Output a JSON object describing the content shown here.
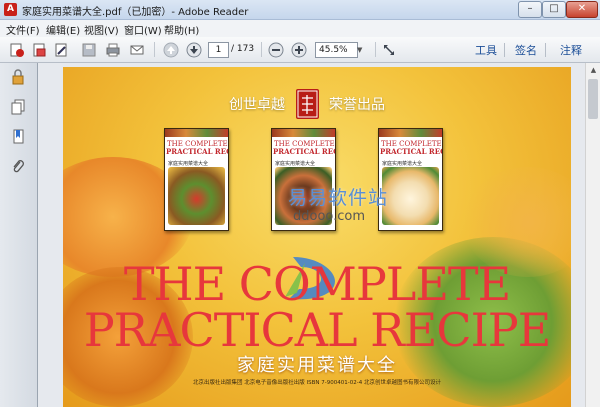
{
  "window": {
    "title": "家庭实用菜谱大全.pdf（已加密）- Adobe Reader",
    "min": "–",
    "max": "□",
    "close": "✕"
  },
  "menu": [
    "文件(F)",
    "编辑(E)",
    "视图(V)",
    "窗口(W)",
    "帮助(H)"
  ],
  "toolbar": {
    "page_current": "1",
    "page_total": "/ 173",
    "zoom": "45.5%",
    "tabs": [
      "工具",
      "签名",
      "注释"
    ]
  },
  "icons": {
    "toolbar": [
      "create-pdf-icon",
      "open-icon",
      "edit-icon",
      "save-icon",
      "print-icon",
      "email-icon",
      "prev-page-icon",
      "next-page-icon",
      "zoom-out-icon",
      "zoom-in-icon",
      "fit-page-icon"
    ],
    "sidebar": [
      "lock-icon",
      "pages-icon",
      "bookmark-icon",
      "attachment-icon"
    ]
  },
  "cover": {
    "publisher_left": "创世卓越",
    "publisher_right": "荣誉出品",
    "books": [
      {
        "t1": "THE COMPLETE",
        "t2": "PRACTICAL RECIPE",
        "t3": "家庭实用菜谱大全"
      },
      {
        "t1": "THE COMPLETE",
        "t2": "PRACTICAL RECIPE",
        "t3": "家庭实用菜谱大全"
      },
      {
        "t1": "THE COMPLETE",
        "t2": "PRACTICAL RECIPE",
        "t3": "家庭实用菜谱大全"
      }
    ],
    "big_line1": "THE COMPLETE",
    "big_line2": "PRACTICAL RECIPE",
    "cn_title": "家庭实用菜谱大全",
    "footer": "北京出版社出版集团  北京电子音像出版社出版     ISBN 7-900401-02-4     北京创世卓越图书有限公司设计"
  },
  "watermark": {
    "text": "易易软件站",
    "url": "ddooo.com"
  },
  "colors": {
    "accent_red": "#e7373c",
    "tab_blue": "#1d4f98",
    "cover_yellow": "#f3c23b"
  }
}
